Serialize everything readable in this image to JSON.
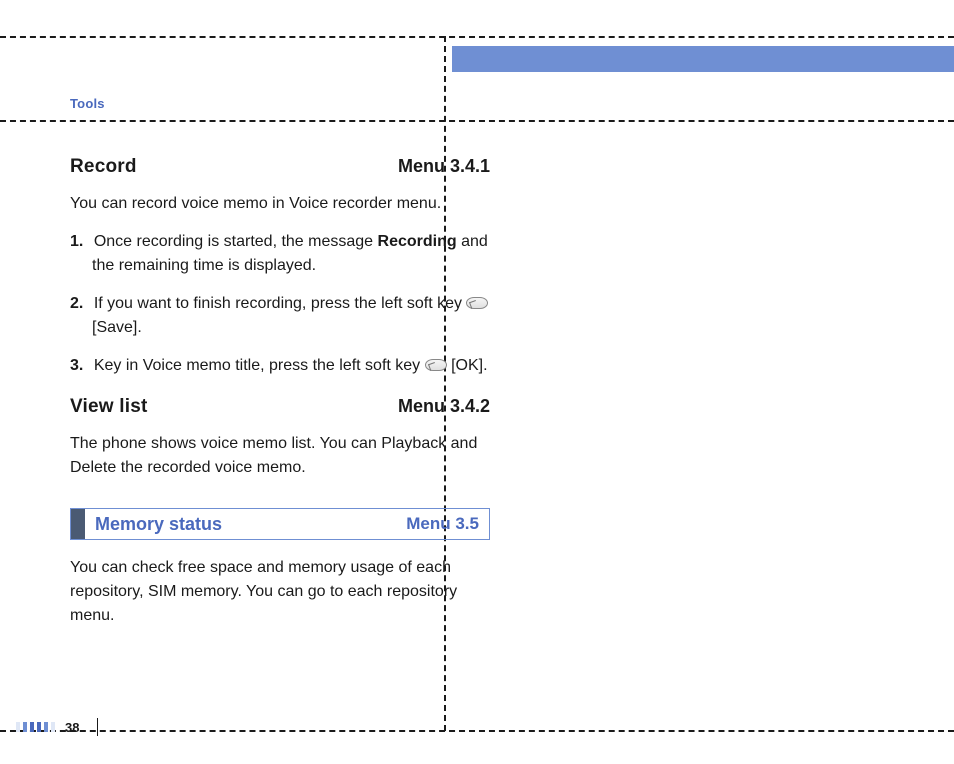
{
  "section_label": "Tools",
  "record": {
    "title": "Record",
    "menu": "Menu 3.4.1",
    "intro": "You can record voice memo in Voice recorder menu.",
    "steps": {
      "s1_a": "Once recording is started, the message ",
      "s1_b": "Recording",
      "s1_c": " and the remaining time is displayed.",
      "s2_a": "If you want to finish recording, press the left soft key ",
      "s2_b": " [Save].",
      "s3_a": "Key in Voice memo title, press the left soft key ",
      "s3_b": " [OK]."
    }
  },
  "viewlist": {
    "title": "View list",
    "menu": "Menu 3.4.2",
    "body": "The phone shows voice memo list. You can Playback and Delete the recorded voice memo."
  },
  "memstatus": {
    "title": "Memory status",
    "menu": "Menu 3.5",
    "body": "You can check free space and memory usage of each repository, SIM memory. You can go to each repository menu."
  },
  "page_number": "38"
}
